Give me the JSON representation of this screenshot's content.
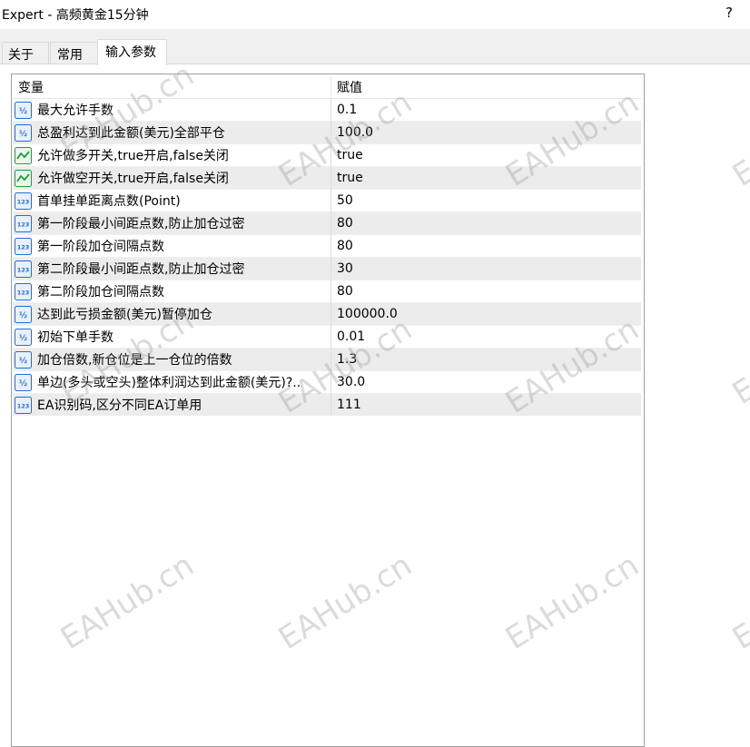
{
  "window": {
    "title": "Expert - 高频黄金15分钟",
    "help_label": "?"
  },
  "tabs": [
    {
      "label": "关于"
    },
    {
      "label": "常用"
    },
    {
      "label": "输入参数"
    }
  ],
  "active_tab": 2,
  "table": {
    "headers": [
      "变量",
      "赋值"
    ],
    "rows": [
      {
        "type": "double",
        "icon": "double-type-icon",
        "name": "最大允许手数",
        "value": "0.1"
      },
      {
        "type": "double",
        "icon": "double-type-icon",
        "name": "总盈利达到此金额(美元)全部平仓",
        "value": "100.0"
      },
      {
        "type": "bool",
        "icon": "bool-type-icon",
        "name": "允许做多开关,true开启,false关闭",
        "value": "true"
      },
      {
        "type": "bool",
        "icon": "bool-type-icon",
        "name": "允许做空开关,true开启,false关闭",
        "value": "true"
      },
      {
        "type": "int",
        "icon": "integer-type-icon",
        "name": "首单挂单距离点数(Point)",
        "value": "50"
      },
      {
        "type": "int",
        "icon": "integer-type-icon",
        "name": "第一阶段最小间距点数,防止加仓过密",
        "value": "80"
      },
      {
        "type": "int",
        "icon": "integer-type-icon",
        "name": "第一阶段加仓间隔点数",
        "value": "80"
      },
      {
        "type": "int",
        "icon": "integer-type-icon",
        "name": "第二阶段最小间距点数,防止加仓过密",
        "value": "30"
      },
      {
        "type": "int",
        "icon": "integer-type-icon",
        "name": "第二阶段加仓间隔点数",
        "value": "80"
      },
      {
        "type": "double",
        "icon": "double-type-icon",
        "name": "达到此亏损金额(美元)暂停加仓",
        "value": "100000.0"
      },
      {
        "type": "double",
        "icon": "double-type-icon",
        "name": "初始下单手数",
        "value": "0.01"
      },
      {
        "type": "double",
        "icon": "double-type-icon",
        "name": "加仓倍数,新仓位是上一仓位的倍数",
        "value": "1.3"
      },
      {
        "type": "double",
        "icon": "double-type-icon",
        "name": "单边(多头或空头)整体利润达到此金额(美元)?..",
        "value": "30.0"
      },
      {
        "type": "int",
        "icon": "integer-type-icon",
        "name": "EA识别码,区分不同EA订单用",
        "value": "111"
      }
    ]
  },
  "watermark_text": "EAHub.cn",
  "colors": {
    "even_row": "#ececec",
    "tab_bg": "#f0f0f0",
    "icon_blue": "#1e6fd6",
    "icon_green": "#1f9d3a"
  }
}
